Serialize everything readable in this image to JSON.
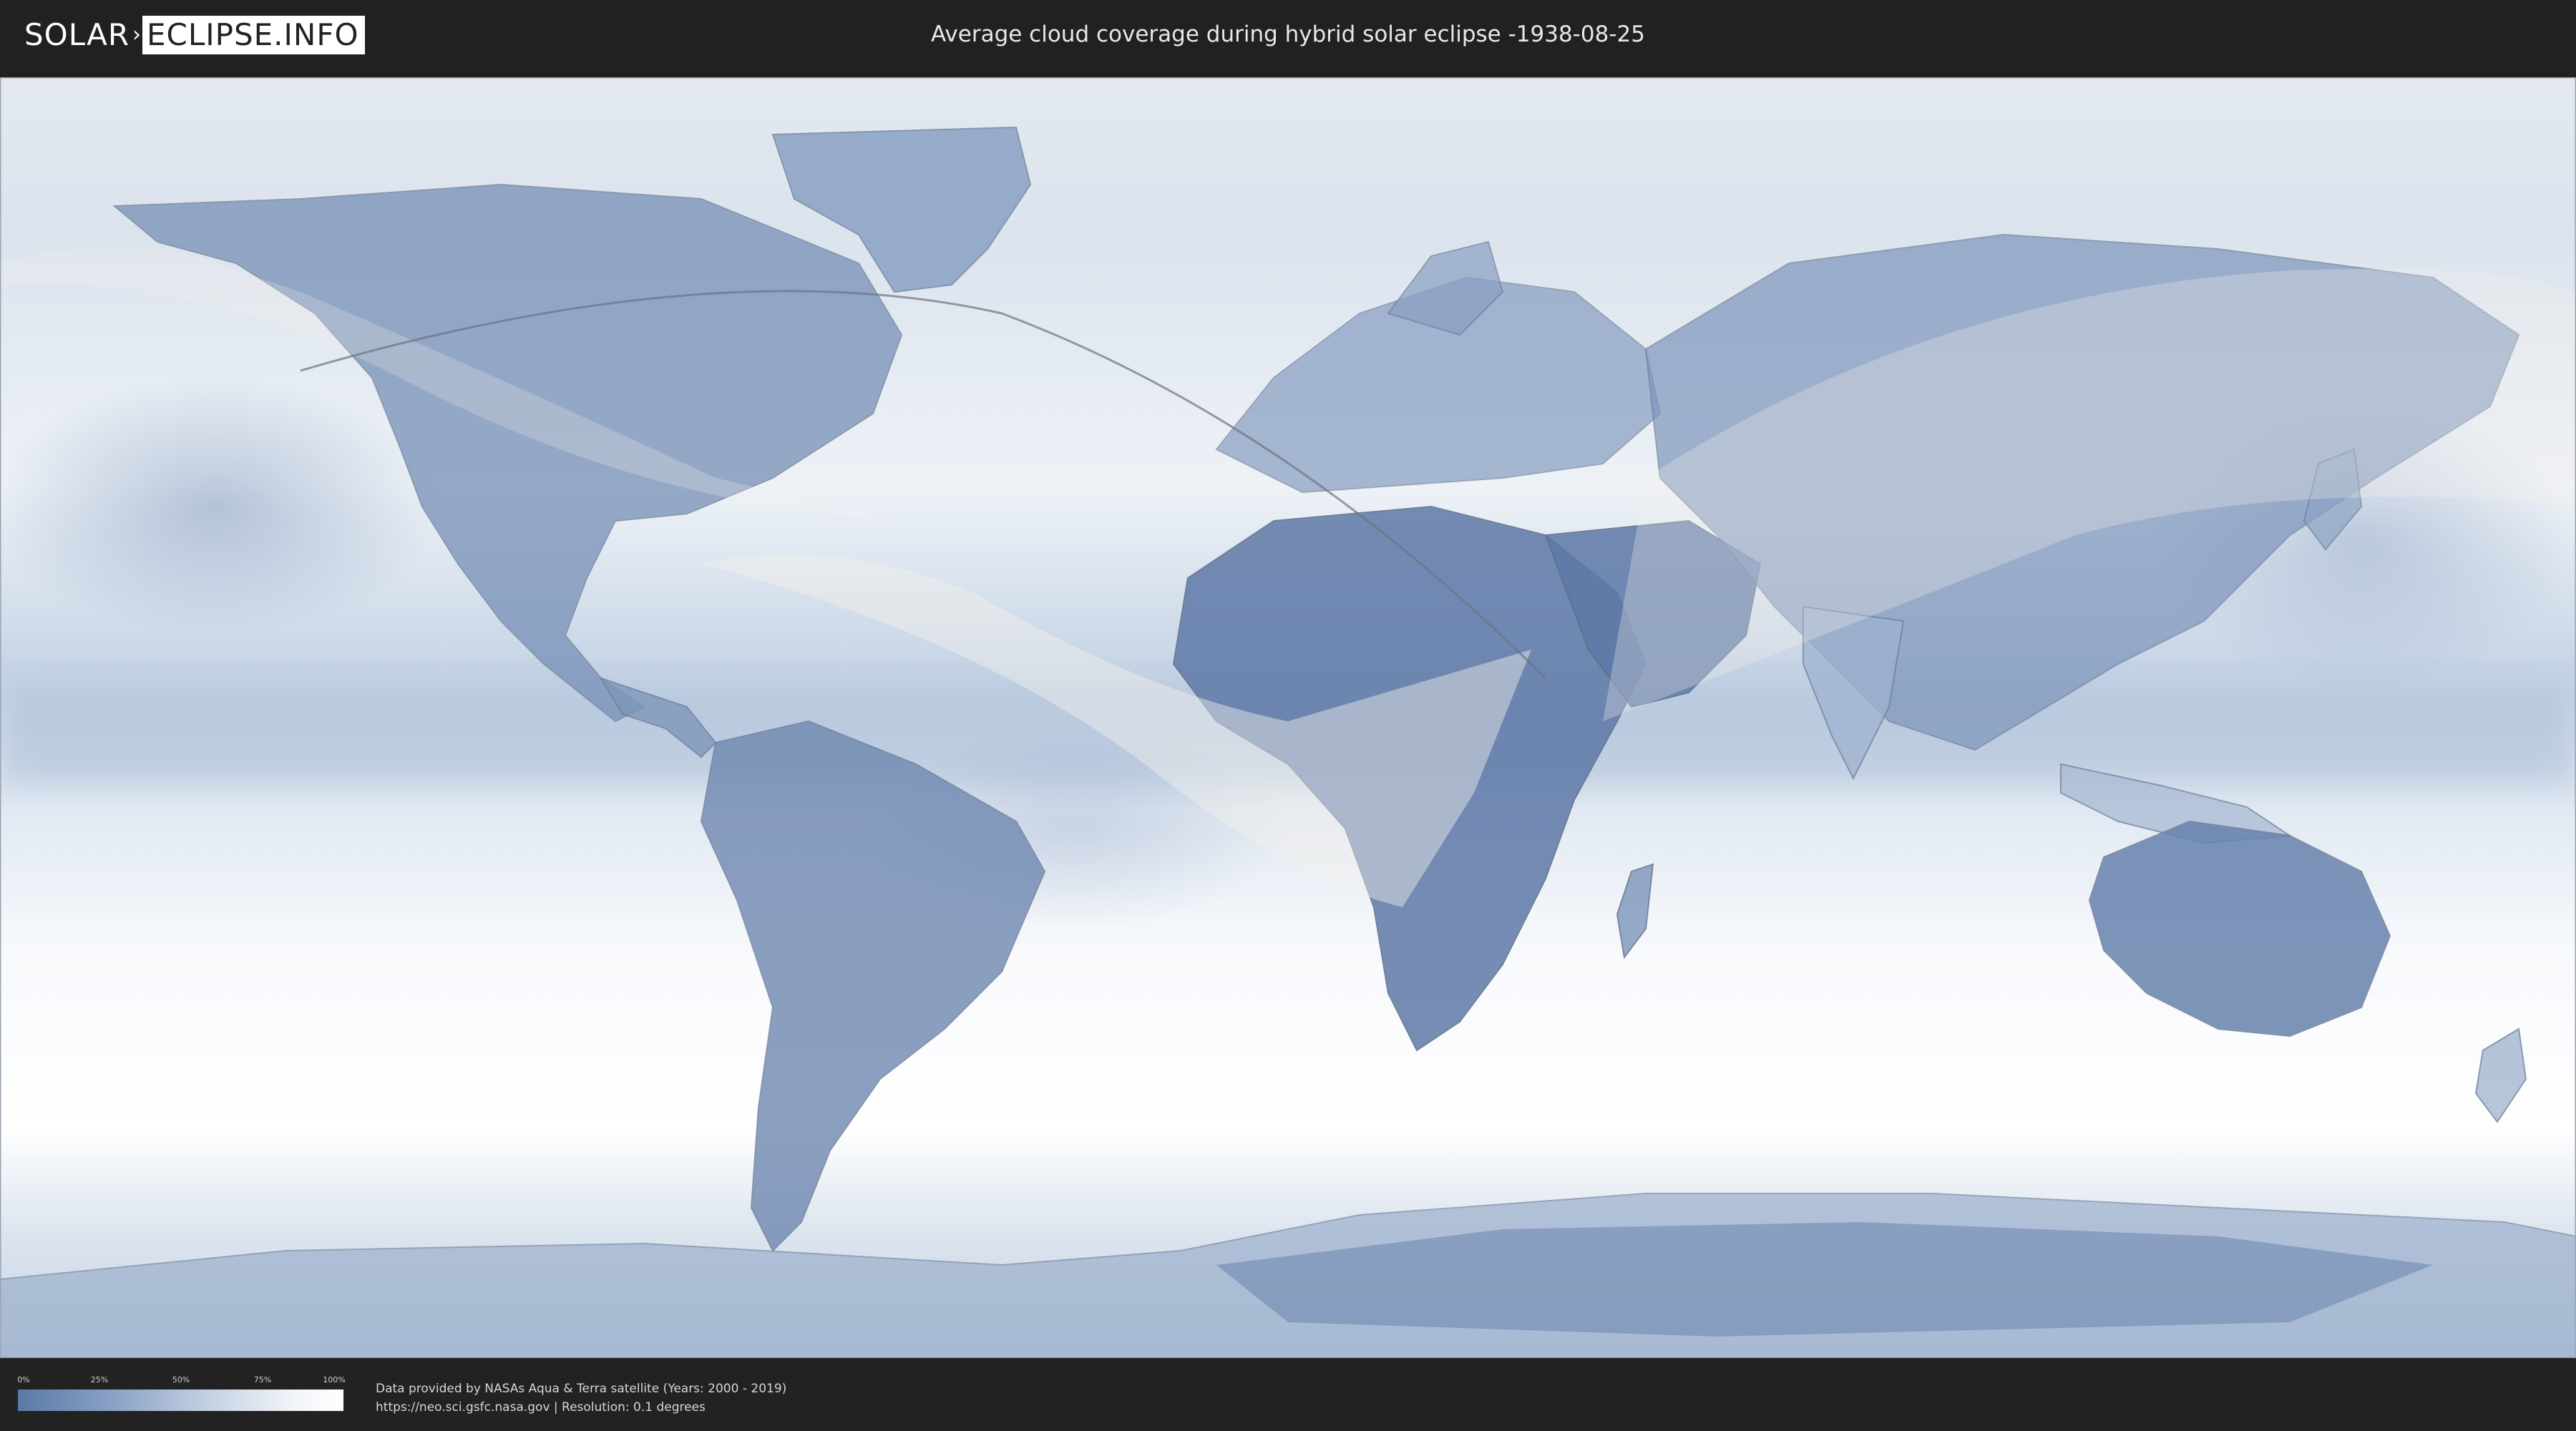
{
  "header": {
    "logo": {
      "left": "SOLAR",
      "right": "ECLIPSE.INFO"
    },
    "title": "Average cloud coverage during hybrid solar eclipse -1938-08-25"
  },
  "map": {
    "colors": {
      "clear": "#5b79a8",
      "cloudy": "#ffffff",
      "polar": "#c9d5e4",
      "eclipse_overlay": "#f2f0ec"
    }
  },
  "legend": {
    "ticks": [
      "0%",
      "25%",
      "50%",
      "75%",
      "100%"
    ]
  },
  "footer": {
    "credit_line1": "Data provided by NASAs Aqua & Terra satellite (Years: 2000 - 2019)",
    "credit_line2": "https://neo.sci.gsfc.nasa.gov | Resolution: 0.1 degrees"
  }
}
